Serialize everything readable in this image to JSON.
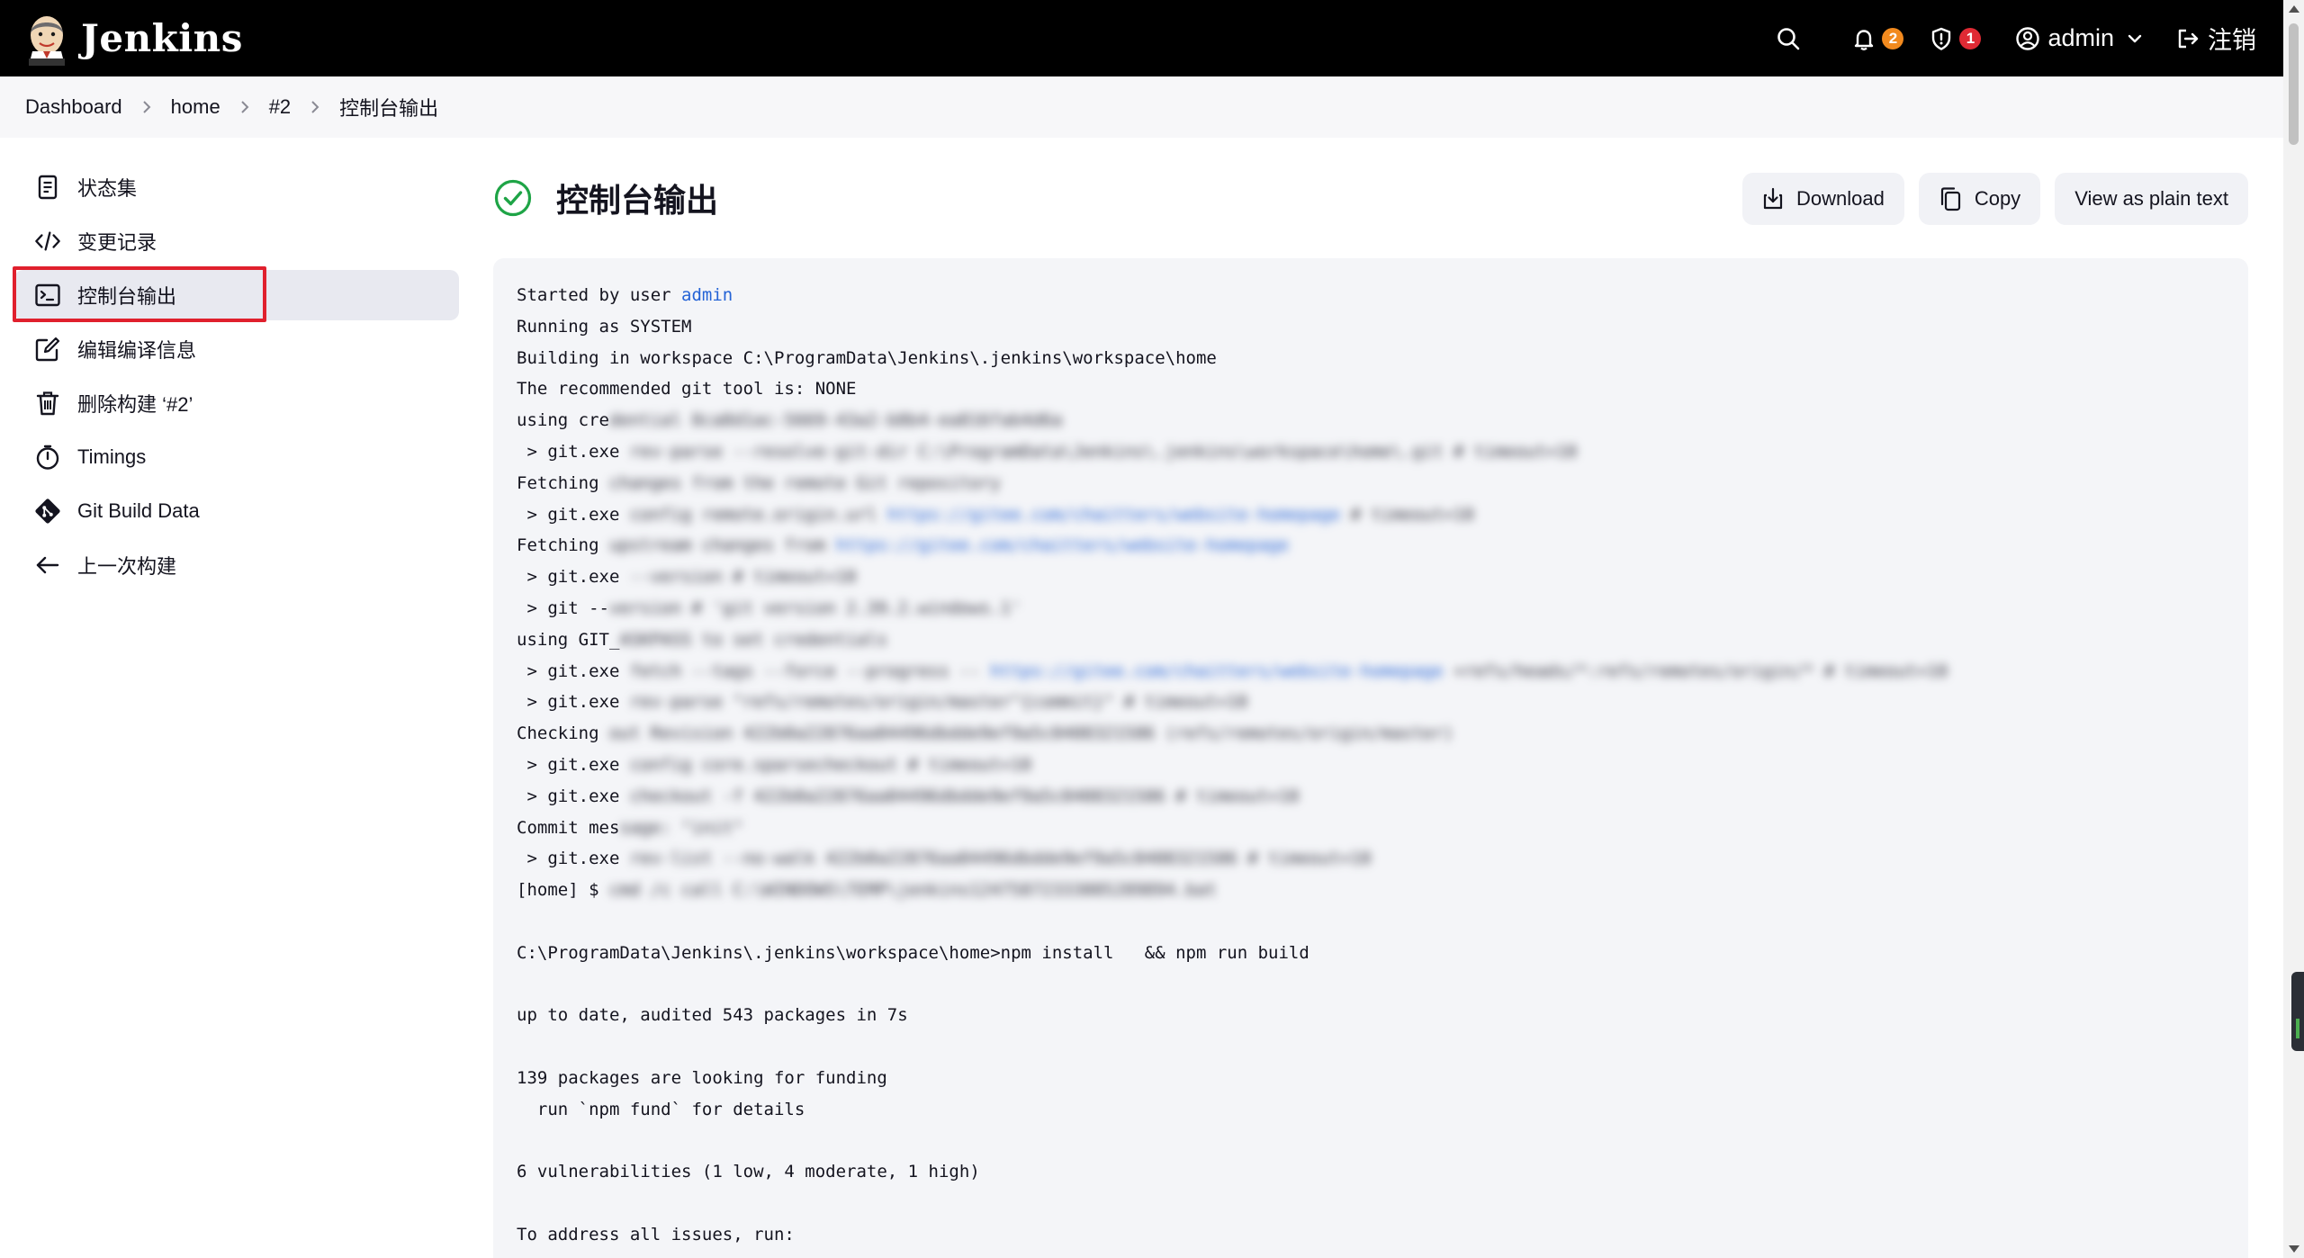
{
  "header": {
    "brand": "Jenkins",
    "notifications_count": "2",
    "security_count": "1",
    "user": "admin",
    "logout": "注销"
  },
  "breadcrumb": [
    "Dashboard",
    "home",
    "#2",
    "控制台输出"
  ],
  "sidebar": {
    "items": [
      {
        "label": "状态集",
        "icon": "document-icon"
      },
      {
        "label": "变更记录",
        "icon": "code-icon"
      },
      {
        "label": "控制台输出",
        "icon": "terminal-icon",
        "active": true
      },
      {
        "label": "编辑编译信息",
        "icon": "edit-icon"
      },
      {
        "label": "删除构建 ‘#2’",
        "icon": "trash-icon"
      },
      {
        "label": "Timings",
        "icon": "stopwatch-icon"
      },
      {
        "label": "Git Build Data",
        "icon": "git-icon"
      },
      {
        "label": "上一次构建",
        "icon": "arrow-left-icon"
      }
    ]
  },
  "main": {
    "title": "控制台输出",
    "status": "success",
    "toolbar": {
      "download": "Download",
      "copy": "Copy",
      "plain": "View as plain text"
    }
  },
  "console": {
    "lines": [
      {
        "text": "Started by user ",
        "link": "admin"
      },
      {
        "text": "Running as SYSTEM"
      },
      {
        "text": "Building in workspace C:\\ProgramData\\Jenkins\\.jenkins\\workspace\\home"
      },
      {
        "text": "The recommended git tool is: NONE"
      },
      {
        "text": "using cre",
        "blurred": "dential 8ca8d1ac-5669-43a2-b8b4-ea816fab4d6a"
      },
      {
        "text": " > git.exe",
        "blurred": " rev-parse --resolve-git-dir C:\\ProgramData\\Jenkins\\.jenkins\\workspace\\home\\.git # timeout=10"
      },
      {
        "text": "Fetching ",
        "blurred": "changes from the remote Git repository"
      },
      {
        "text": " > git.exe",
        "blurred": " config remote.origin.url ",
        "blurred_link": "https://gitee.com/chaitters/website-homepage",
        "blurred_tail": " # timeout=10"
      },
      {
        "text": "Fetching ",
        "blurred": "upstream changes from ",
        "blurred_link": "https://gitee.com/chaitters/website-homepage"
      },
      {
        "text": " > git.exe",
        "blurred": " --version # timeout=10"
      },
      {
        "text": " > git --",
        "blurred": "version # 'git version 2.39.2.windows.1'"
      },
      {
        "text": "using GIT_",
        "blurred": "ASKPASS to set credentials"
      },
      {
        "text": " > git.exe",
        "blurred": " fetch --tags --force --progress -- ",
        "blurred_link": "https://gitee.com/chaitters/website-homepage",
        "blurred_tail": " +refs/heads/*:refs/remotes/origin/* # timeout=10"
      },
      {
        "text": " > git.exe",
        "blurred": " rev-parse \"refs/remotes/origin/master^{commit}\" # timeout=10"
      },
      {
        "text": "Checking ",
        "blurred": "out Revision 422b0a22876aa04496dbdde9ef9a5c0408321586 (refs/remotes/origin/master)"
      },
      {
        "text": " > git.exe",
        "blurred": " config core.sparsecheckout # timeout=10"
      },
      {
        "text": " > git.exe",
        "blurred": " checkout -f 422b0a22876aa04496dbdde9ef9a5c0408321586 # timeout=10"
      },
      {
        "text": "Commit mes",
        "blurred": "sage: \"init\""
      },
      {
        "text": " > git.exe",
        "blurred": " rev-list --no-walk 422b0a22876aa04496dbdde9ef9a5c0408321586 # timeout=10"
      },
      {
        "text": "[home] $ ",
        "blurred": "cmd /c call C:\\WINDOWS\\TEMP\\jenkins12475872333005289894.bat"
      },
      {
        "text": ""
      },
      {
        "text": "C:\\ProgramData\\Jenkins\\.jenkins\\workspace\\home>npm install   && npm run build"
      },
      {
        "text": ""
      },
      {
        "text": "up to date, audited 543 packages in 7s"
      },
      {
        "text": ""
      },
      {
        "text": "139 packages are looking for funding"
      },
      {
        "text": "  run `npm fund` for details"
      },
      {
        "text": ""
      },
      {
        "text": "6 vulnerabilities (1 low, 4 moderate, 1 high)"
      },
      {
        "text": ""
      },
      {
        "text": "To address all issues, run:"
      }
    ]
  }
}
